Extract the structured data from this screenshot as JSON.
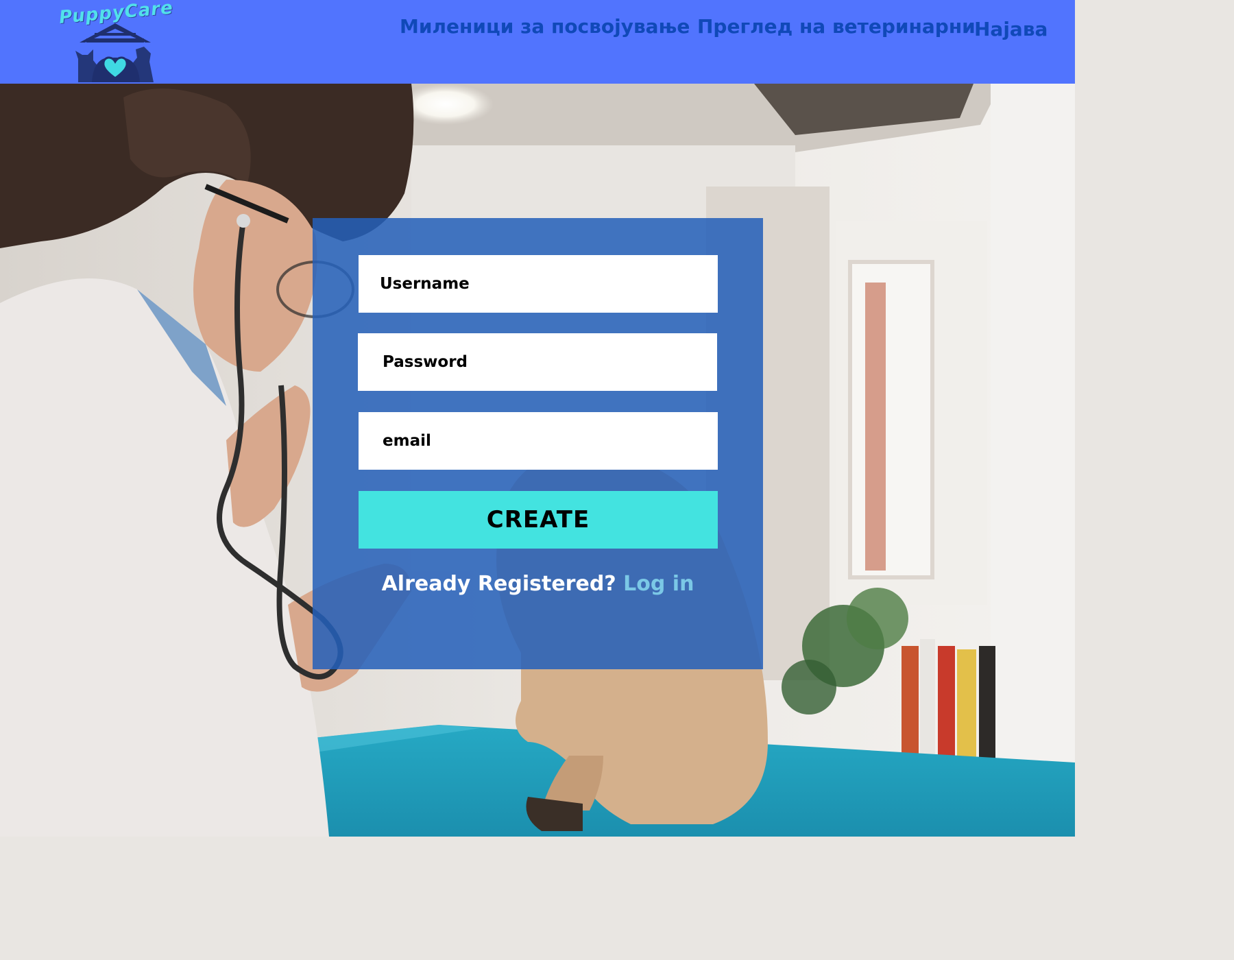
{
  "brand": {
    "logo_text": "PuppyCare"
  },
  "nav": {
    "items": [
      {
        "label": "Миленици за посвојување"
      },
      {
        "label": "Преглед на ветеринарни"
      },
      {
        "label": "Најава"
      }
    ]
  },
  "form": {
    "username_placeholder": "Username",
    "password_placeholder": "Password",
    "email_placeholder": "email",
    "create_label": "CREATE",
    "already_text": "Already Registered? ",
    "login_link": "Log in"
  },
  "colors": {
    "header_bg": "#5174fe",
    "nav_text": "#1049b8",
    "card_bg": "#245fb9",
    "button_bg": "#43e3e0",
    "link": "#7bc8e6"
  },
  "icons": {
    "logo": "house-dog-cat-heart-icon"
  }
}
